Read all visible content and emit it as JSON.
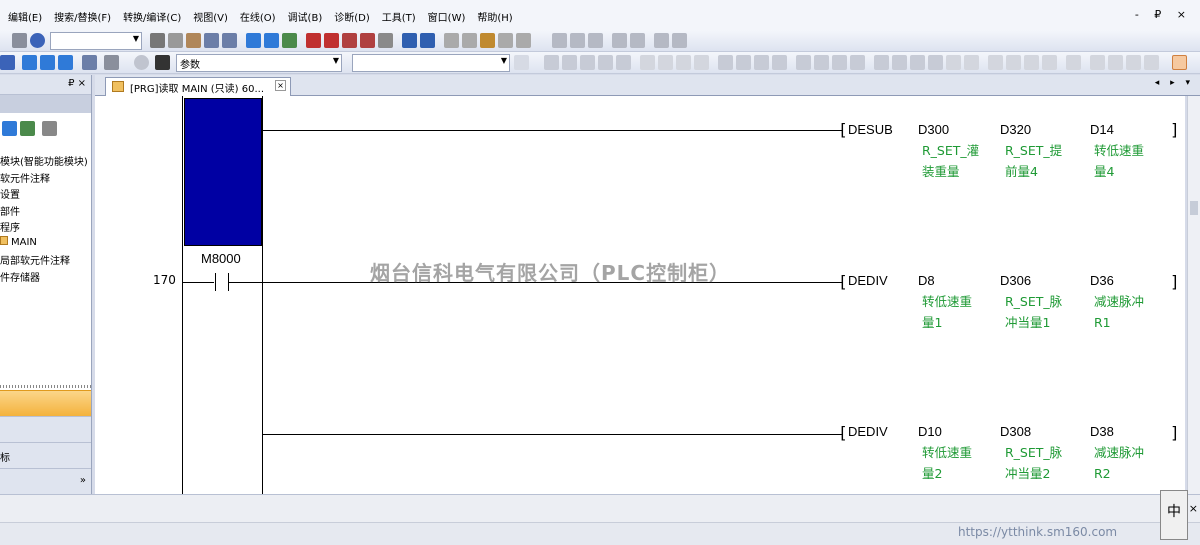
{
  "menubar": {
    "items": [
      "编辑(E)",
      "搜索/替换(F)",
      "转换/编译(C)",
      "视图(V)",
      "在线(O)",
      "调试(B)",
      "诊断(D)",
      "工具(T)",
      "窗口(W)",
      "帮助(H)"
    ],
    "window_controls": "- ₽ ×"
  },
  "toolbar2": {
    "param_combo": "参数"
  },
  "left_panel": {
    "pin": "₽ ×",
    "tree": [
      "模块(智能功能模块)",
      "软元件注释",
      "设置",
      "部件",
      "程序",
      "MAIN",
      "局部软元件注释",
      "件存储器"
    ],
    "tab1": "",
    "tab2": "",
    "tab3": "标",
    "expand": "»"
  },
  "doc_tab": {
    "label": "[PRG]读取 MAIN (只读) 60...",
    "close": "×",
    "nav": "◂ ▸ ▾"
  },
  "ladder": {
    "step": "170",
    "contact": "M8000",
    "rungs": [
      {
        "instr": "DESUB",
        "ops": [
          "D300",
          "D320",
          "D14"
        ],
        "comments": [
          "R_SET_灌\n装重量",
          "R_SET_提\n前量4",
          "转低速重\n量4"
        ]
      },
      {
        "instr": "DEDIV",
        "ops": [
          "D8",
          "D306",
          "D36"
        ],
        "comments": [
          "转低速重\n量1",
          "R_SET_脉\n冲当量1",
          "减速脉冲\nR1"
        ]
      },
      {
        "instr": "DEDIV",
        "ops": [
          "D10",
          "D308",
          "D38"
        ],
        "comments": [
          "转低速重\n量2",
          "R_SET_脉\n冲当量2",
          "减速脉冲\nR2"
        ]
      }
    ]
  },
  "watermark": "烟台信科电气有限公司（PLC控制柜）",
  "ime": "中",
  "url": "https://ytthink.sm160.com",
  "colors": {
    "cursor": "#0000a3",
    "comment": "#1f9a35",
    "orange": "#f4b23c"
  }
}
